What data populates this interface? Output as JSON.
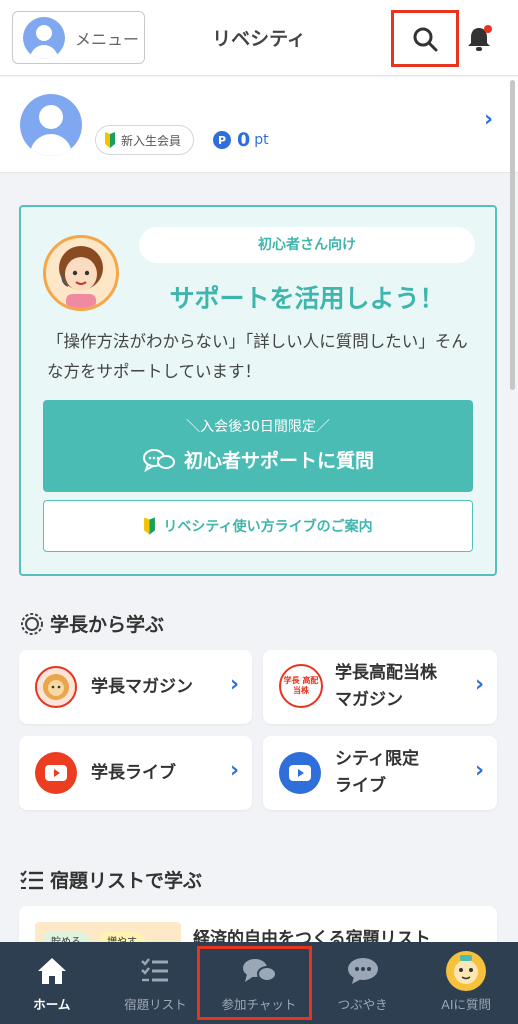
{
  "header": {
    "menu_label": "メニュー",
    "title": "リベシティ",
    "search_icon": "search-icon",
    "bell_icon": "bell-icon",
    "highlight_color": "#e8341f"
  },
  "profile": {
    "badge_label": "新入生会員",
    "points_symbol": "P",
    "points_value": "0",
    "points_unit": "pt"
  },
  "support": {
    "bubble": "初心者さん向け",
    "title": "サポートを活用しよう！",
    "desc": "「操作方法がわからない」「詳しい人に質問したい」そんな方をサポートしています！",
    "button_sub": "＼入会後30日間限定／",
    "button_main": "初心者サポートに質問",
    "live_link": "リベシティ使い方ライブのご案内",
    "accent": "#4bbcb4"
  },
  "learn_from_chief": {
    "title": "学長から学ぶ",
    "cards": [
      {
        "label": "学長マガジン",
        "icon": "lion-icon"
      },
      {
        "label1": "学長高配当株",
        "label2": "マガジン",
        "icon_text": "学長 高配当株",
        "icon": "stock-magazine-icon"
      },
      {
        "label": "学長ライブ",
        "icon": "youtube-icon"
      },
      {
        "label1": "シティ限定",
        "label2": "ライブ",
        "icon": "youtube-icon"
      }
    ]
  },
  "homework": {
    "title": "宿題リストで学ぶ",
    "card_title": "経済的自由をつくる宿題リスト",
    "tags": [
      "貯める",
      "増やす"
    ]
  },
  "nav": {
    "items": [
      {
        "label": "ホーム",
        "icon": "home-icon"
      },
      {
        "label": "宿題リスト",
        "icon": "checklist-icon"
      },
      {
        "label": "参加チャット",
        "icon": "chat-icon"
      },
      {
        "label": "つぶやき",
        "icon": "tweet-icon"
      },
      {
        "label": "AIに質問",
        "icon": "ai-lion-icon"
      }
    ]
  }
}
